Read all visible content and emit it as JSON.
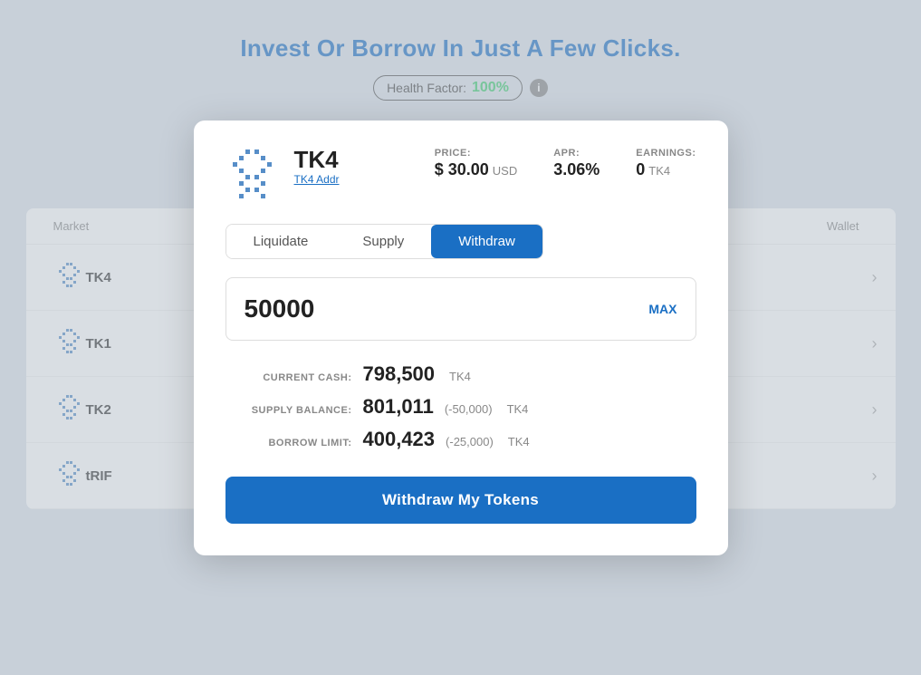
{
  "page": {
    "title": "Invest Or Borrow In Just A Few Clicks.",
    "health_factor_label": "Health Factor:",
    "health_factor_value": "100%",
    "info_icon": "i"
  },
  "market_table": {
    "headers": [
      "Market",
      "Wallet"
    ],
    "rows": [
      {
        "symbol": "TK4",
        "id": "tk4"
      },
      {
        "symbol": "TK1",
        "id": "tk1"
      },
      {
        "symbol": "TK2",
        "id": "tk2"
      },
      {
        "symbol": "tRIF",
        "id": "trif"
      }
    ]
  },
  "modal": {
    "token_name": "TK4",
    "token_addr_label": "TK4 Addr",
    "price_label": "PRICE:",
    "price_value": "$ 30.00",
    "price_currency": "USD",
    "apr_label": "APR:",
    "apr_value": "3.06%",
    "earnings_label": "EARNINGS:",
    "earnings_value": "0",
    "earnings_currency": "TK4",
    "tabs": [
      "Liquidate",
      "Supply",
      "Withdraw"
    ],
    "active_tab": "Withdraw",
    "amount_value": "50000",
    "amount_placeholder": "0",
    "max_label": "MAX",
    "current_cash_label": "CURRENT CASH:",
    "current_cash_value": "798,500",
    "current_cash_unit": "TK4",
    "supply_balance_label": "SUPPLY BALANCE:",
    "supply_balance_value": "801,011",
    "supply_balance_delta": "(-50,000)",
    "supply_balance_unit": "TK4",
    "borrow_limit_label": "BORROW LIMIT:",
    "borrow_limit_value": "400,423",
    "borrow_limit_delta": "(-25,000)",
    "borrow_limit_unit": "TK4",
    "withdraw_btn_label": "Withdraw My Tokens"
  },
  "colors": {
    "primary": "#1a6fc4",
    "health_green": "#3dcc6e",
    "token_blue": "#3a7bbf"
  }
}
